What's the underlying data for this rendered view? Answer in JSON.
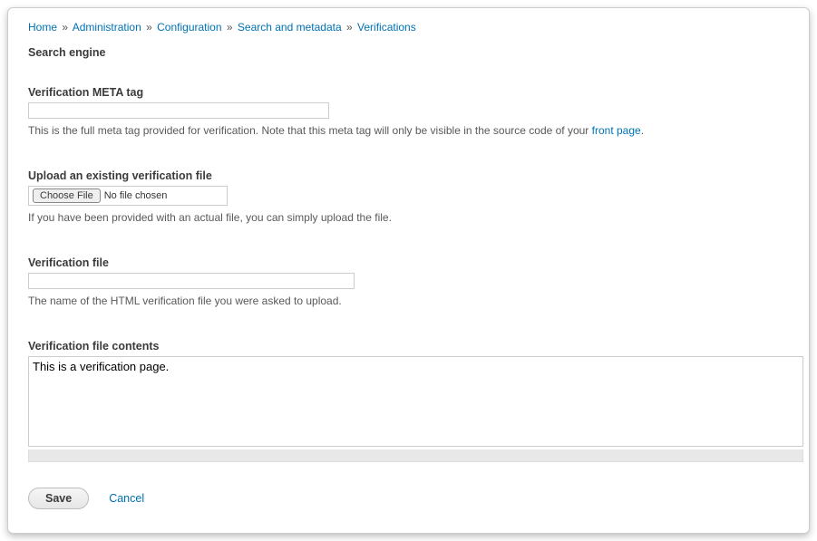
{
  "breadcrumb": {
    "items": [
      {
        "label": "Home"
      },
      {
        "label": "Administration"
      },
      {
        "label": "Configuration"
      },
      {
        "label": "Search and metadata"
      },
      {
        "label": "Verifications"
      }
    ],
    "separator": "»"
  },
  "heading": "Search engine",
  "meta_tag": {
    "label": "Verification META tag",
    "value": "",
    "help_prefix": "This is the full meta tag provided for verification. Note that this meta tag will only be visible in the source code of your ",
    "help_link": "front page",
    "help_suffix": "."
  },
  "upload": {
    "label": "Upload an existing verification file",
    "choose_button": "Choose File",
    "status": "No file chosen",
    "help": "If you have been provided with an actual file, you can simply upload the file."
  },
  "verification_file": {
    "label": "Verification file",
    "value": "",
    "help": "The name of the HTML verification file you were asked to upload."
  },
  "file_contents": {
    "label": "Verification file contents",
    "value": "This is a verification page."
  },
  "actions": {
    "save": "Save",
    "cancel": "Cancel"
  }
}
